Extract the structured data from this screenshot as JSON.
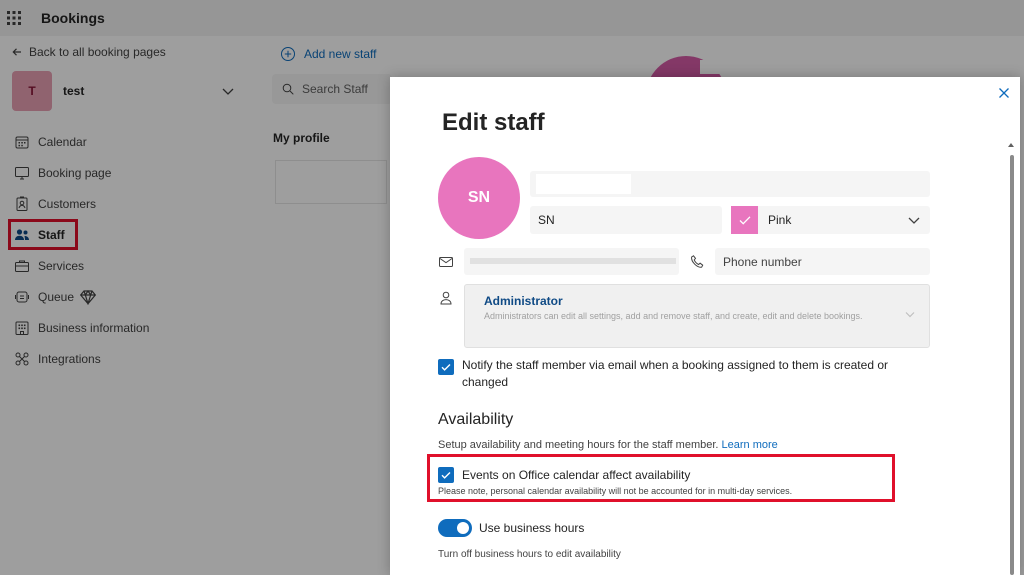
{
  "app": {
    "title": "Bookings"
  },
  "sidebar": {
    "back_label": "Back to all booking pages",
    "page": {
      "initial": "T",
      "name": "test"
    },
    "items": [
      {
        "label": "Calendar",
        "icon": "calendar-icon"
      },
      {
        "label": "Booking page",
        "icon": "monitor-icon"
      },
      {
        "label": "Customers",
        "icon": "contact-card-icon"
      },
      {
        "label": "Staff",
        "icon": "people-icon",
        "active": true
      },
      {
        "label": "Services",
        "icon": "briefcase-icon"
      },
      {
        "label": "Queue",
        "icon": "queue-icon"
      },
      {
        "label": "Business information",
        "icon": "building-icon"
      },
      {
        "label": "Integrations",
        "icon": "integrations-icon"
      }
    ]
  },
  "staff_list": {
    "add_label": "Add new staff",
    "search_placeholder": "Search Staff",
    "my_profile_label": "My profile"
  },
  "dialog": {
    "title": "Edit staff",
    "avatar_initials": "SN",
    "initials_value": "SN",
    "color_label": "Pink",
    "phone_placeholder": "Phone number",
    "role": {
      "title": "Administrator",
      "description": "Administrators can edit all settings, add and remove staff, and create, edit and delete bookings."
    },
    "notify_label": "Notify the staff member via email when a booking assigned to them is created or changed",
    "availability": {
      "title": "Availability",
      "description": "Setup availability and meeting hours for the staff member.",
      "learn_more": "Learn more",
      "events_label": "Events on Office calendar affect availability",
      "events_note": "Please note, personal calendar availability will not be accounted for in multi-day services.",
      "business_hours_label": "Use business hours",
      "business_hours_note": "Turn off business hours to edit availability"
    }
  },
  "colors": {
    "accent": "#0f6cbd",
    "avatar_pink": "#e875be",
    "highlight_red": "#e0102b"
  }
}
